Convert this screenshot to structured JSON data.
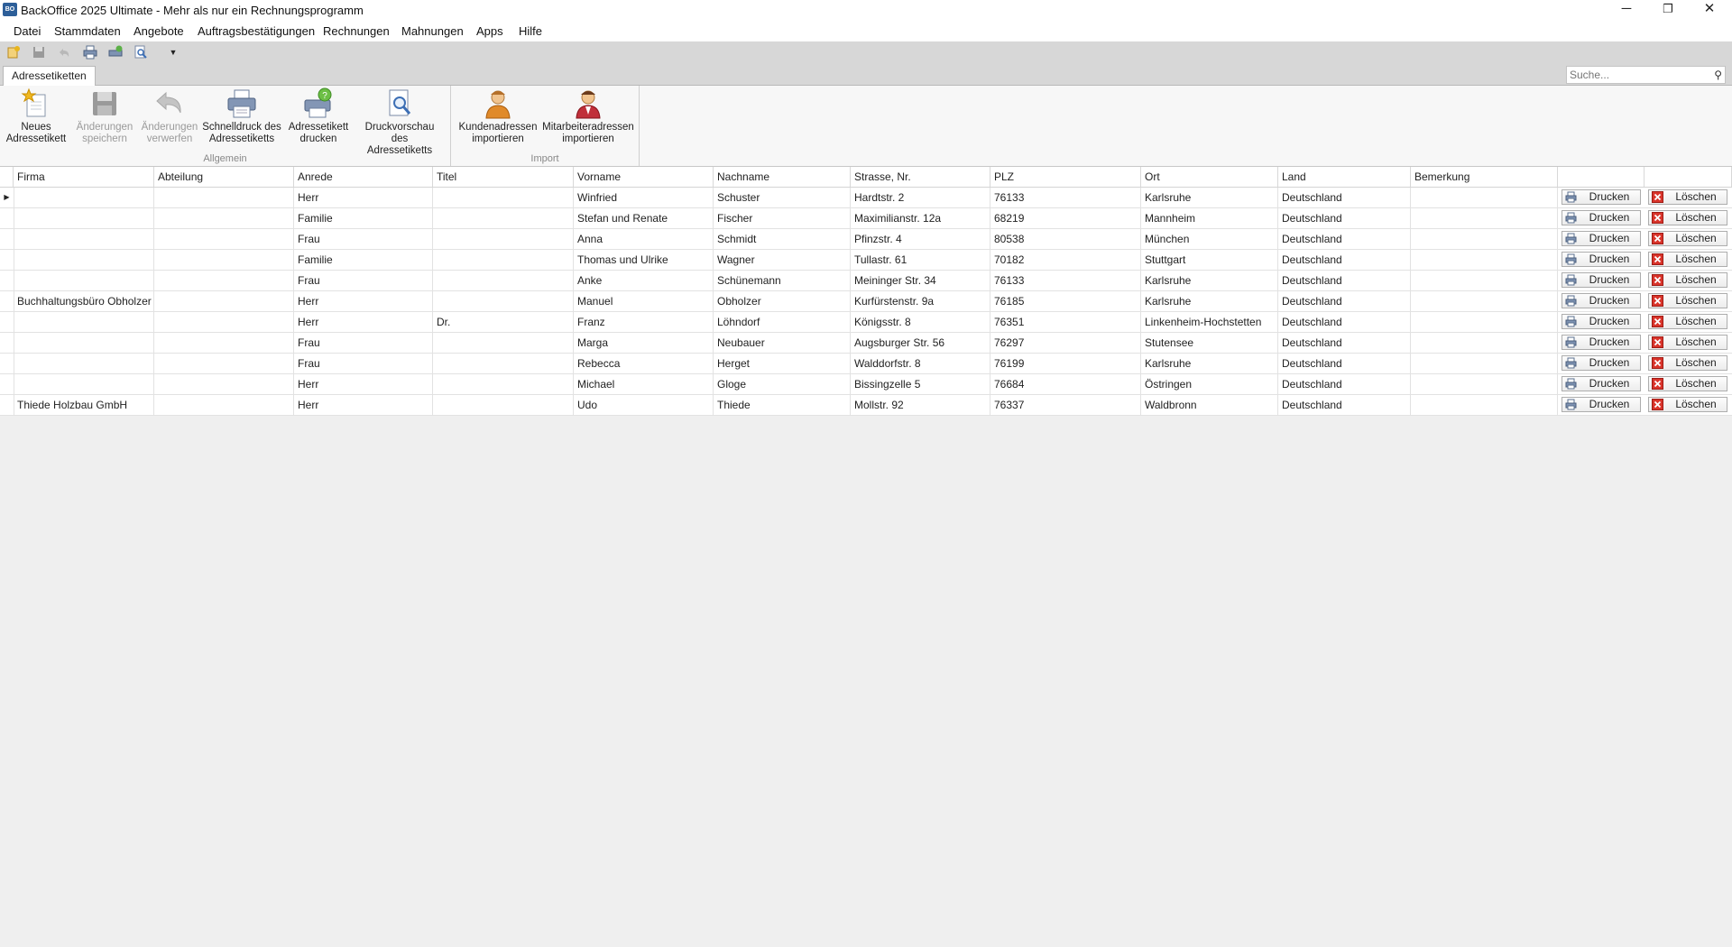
{
  "window": {
    "title": "BackOffice 2025 Ultimate - Mehr als nur ein Rechnungsprogramm",
    "app_icon_text": "BO",
    "minimize": "─",
    "maximize": "❐",
    "close": "✕"
  },
  "menu": [
    "Datei",
    "Stammdaten",
    "Angebote",
    "Auftragsbestätigungen",
    "Rechnungen",
    "Mahnungen",
    "Apps",
    "Hilfe"
  ],
  "quick_access": [
    "new-icon",
    "save-icon",
    "undo-icon",
    "print-icon",
    "print-address-icon",
    "preview-icon",
    "dropdown-arrow-icon"
  ],
  "tab": {
    "label": "Adressetiketten"
  },
  "search": {
    "placeholder": "Suche..."
  },
  "ribbon": {
    "groups": [
      {
        "label": "Allgemein",
        "buttons": [
          {
            "line1": "Neues",
            "line2": "Adressetikett",
            "icon": "new-label-icon",
            "enabled": true
          },
          {
            "line1": "Änderungen",
            "line2": "speichern",
            "icon": "save-icon",
            "enabled": false
          },
          {
            "line1": "Änderungen",
            "line2": "verwerfen",
            "icon": "undo-icon",
            "enabled": false
          },
          {
            "line1": "Schnelldruck des",
            "line2": "Adressetiketts",
            "icon": "quick-print-icon",
            "enabled": true
          },
          {
            "line1": "Adressetikett",
            "line2": "drucken",
            "icon": "print-label-icon",
            "enabled": true
          },
          {
            "line1": "Druckvorschau des",
            "line2": "Adressetiketts",
            "icon": "print-preview-icon",
            "enabled": true
          }
        ]
      },
      {
        "label": "Import",
        "buttons": [
          {
            "line1": "Kundenadressen",
            "line2": "importieren",
            "icon": "customer-import-icon",
            "enabled": true
          },
          {
            "line1": "Mitarbeiteradressen",
            "line2": "importieren",
            "icon": "employee-import-icon",
            "enabled": true
          }
        ]
      }
    ]
  },
  "table": {
    "columns": [
      "Firma",
      "Abteilung",
      "Anrede",
      "Titel",
      "Vorname",
      "Nachname",
      "Strasse, Nr.",
      "PLZ",
      "Ort",
      "Land",
      "Bemerkung"
    ],
    "print_label": "Drucken",
    "delete_label": "Löschen",
    "selected_row": 0,
    "rows": [
      [
        "",
        "",
        "Herr",
        "",
        "Winfried",
        "Schuster",
        "Hardtstr. 2",
        "76133",
        "Karlsruhe",
        "Deutschland",
        ""
      ],
      [
        "",
        "",
        "Familie",
        "",
        "Stefan und Renate",
        "Fischer",
        "Maximilianstr. 12a",
        "68219",
        "Mannheim",
        "Deutschland",
        ""
      ],
      [
        "",
        "",
        "Frau",
        "",
        "Anna",
        "Schmidt",
        "Pfinzstr. 4",
        "80538",
        "München",
        "Deutschland",
        ""
      ],
      [
        "",
        "",
        "Familie",
        "",
        "Thomas und Ulrike",
        "Wagner",
        "Tullastr. 61",
        "70182",
        "Stuttgart",
        "Deutschland",
        ""
      ],
      [
        "",
        "",
        "Frau",
        "",
        "Anke",
        "Schünemann",
        "Meininger Str. 34",
        "76133",
        "Karlsruhe",
        "Deutschland",
        ""
      ],
      [
        "Buchhaltungsbüro Obholzer",
        "",
        "Herr",
        "",
        "Manuel",
        "Obholzer",
        "Kurfürstenstr. 9a",
        "76185",
        "Karlsruhe",
        "Deutschland",
        ""
      ],
      [
        "",
        "",
        "Herr",
        "Dr.",
        "Franz",
        "Löhndorf",
        "Königsstr. 8",
        "76351",
        "Linkenheim-Hochstetten",
        "Deutschland",
        ""
      ],
      [
        "",
        "",
        "Frau",
        "",
        "Marga",
        "Neubauer",
        "Augsburger Str. 56",
        "76297",
        "Stutensee",
        "Deutschland",
        ""
      ],
      [
        "",
        "",
        "Frau",
        "",
        "Rebecca",
        "Herget",
        "Walddorfstr. 8",
        "76199",
        "Karlsruhe",
        "Deutschland",
        ""
      ],
      [
        "",
        "",
        "Herr",
        "",
        "Michael",
        "Gloge",
        "Bissingzelle 5",
        "76684",
        "Östringen",
        "Deutschland",
        ""
      ],
      [
        "Thiede Holzbau GmbH",
        "",
        "Herr",
        "",
        "Udo",
        "Thiede",
        "Mollstr. 92",
        "76337",
        "Waldbronn",
        "Deutschland",
        ""
      ]
    ]
  }
}
